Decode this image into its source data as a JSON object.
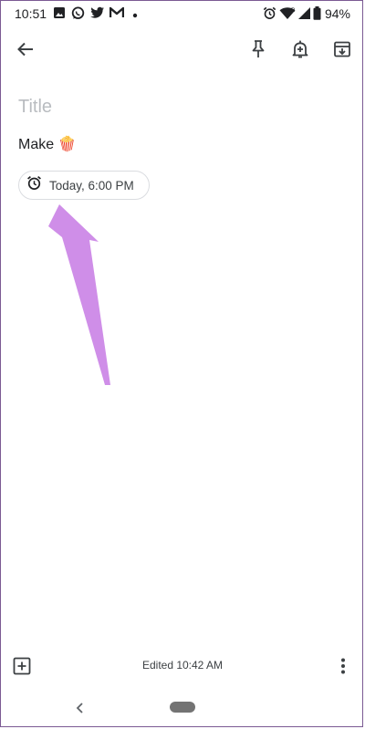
{
  "status_bar": {
    "time": "10:51",
    "battery": "94%",
    "icons": [
      "image-icon",
      "whatsapp-icon",
      "twitter-icon",
      "gmail-icon",
      "dot-icon",
      "alarm-icon",
      "wifi-icon",
      "signal-icon",
      "battery-icon"
    ]
  },
  "toolbar": {
    "icons": [
      "back-arrow-icon",
      "pin-icon",
      "add-reminder-icon",
      "archive-icon"
    ]
  },
  "note": {
    "title_placeholder": "Title",
    "text": "Make 🍿",
    "reminder": "Today, 6:00 PM"
  },
  "bottom_bar": {
    "edited": "Edited 10:42 AM",
    "icons": [
      "add-box-icon",
      "more-vert-icon"
    ]
  },
  "colors": {
    "arrow": "#cf8ee8",
    "text": "#202124",
    "placeholder": "#b9bcc0",
    "chip_border": "#dadce0"
  }
}
